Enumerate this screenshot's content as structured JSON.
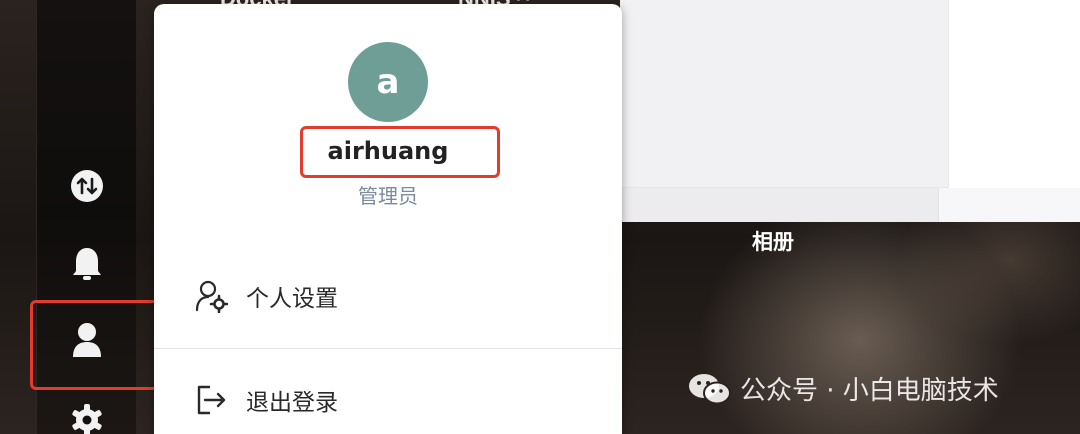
{
  "background": {
    "top_fragments": [
      "Docker",
      "NNIS ^"
    ],
    "album_label": "相册",
    "watermark": "公众号 · 小白电脑技术"
  },
  "sidebar": {
    "items": [
      {
        "name": "transfer",
        "icon": "transfer-arrows-icon"
      },
      {
        "name": "notifications",
        "icon": "bell-icon"
      },
      {
        "name": "user",
        "icon": "user-icon",
        "highlighted": true
      },
      {
        "name": "settings",
        "icon": "gear-icon"
      }
    ]
  },
  "user_menu": {
    "avatar_letter": "a",
    "avatar_color": "#6e9e96",
    "username": "airhuang",
    "role": "管理员",
    "items": [
      {
        "label": "个人设置",
        "icon": "user-settings-icon"
      },
      {
        "label": "退出登录",
        "icon": "logout-icon"
      }
    ]
  },
  "colors": {
    "highlight": "#e23c2c",
    "role_text": "#7c8a9d"
  }
}
